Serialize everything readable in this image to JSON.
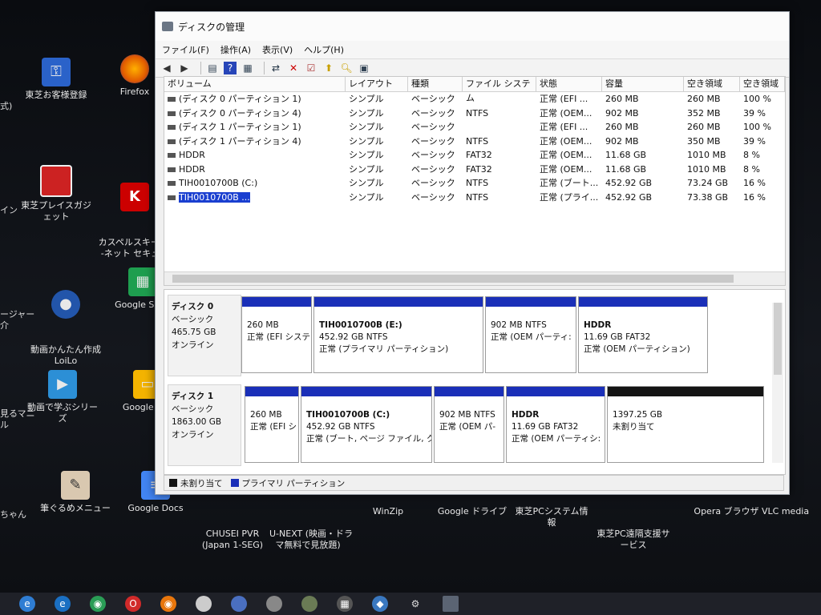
{
  "window": {
    "title": "ディスクの管理",
    "menu": [
      "ファイル(F)",
      "操作(A)",
      "表示(V)",
      "ヘルプ(H)"
    ]
  },
  "toolbar_icons": [
    "back-icon",
    "forward-icon",
    "list-view-icon",
    "help-icon",
    "properties-icon",
    "connect-icon",
    "delete-icon",
    "checklist-icon",
    "up-icon",
    "search-icon",
    "settings-icon"
  ],
  "list": {
    "columns": [
      "ボリューム",
      "レイアウト",
      "種類",
      "ファイル システム",
      "状態",
      "容量",
      "空き領域",
      "空き領域"
    ],
    "rows": [
      [
        "(ディスク 0 パーティション 1)",
        "シンプル",
        "ベーシック",
        "",
        "正常 (EFI ...",
        "260 MB",
        "260 MB",
        "100 %"
      ],
      [
        "(ディスク 0 パーティション 4)",
        "シンプル",
        "ベーシック",
        "NTFS",
        "正常 (OEM...",
        "902 MB",
        "352 MB",
        "39 %"
      ],
      [
        "(ディスク 1 パーティション 1)",
        "シンプル",
        "ベーシック",
        "",
        "正常 (EFI ...",
        "260 MB",
        "260 MB",
        "100 %"
      ],
      [
        "(ディスク 1 パーティション 4)",
        "シンプル",
        "ベーシック",
        "NTFS",
        "正常 (OEM...",
        "902 MB",
        "350 MB",
        "39 %"
      ],
      [
        "HDDR",
        "シンプル",
        "ベーシック",
        "FAT32",
        "正常 (OEM...",
        "11.68 GB",
        "1010 MB",
        "8 %"
      ],
      [
        "HDDR",
        "シンプル",
        "ベーシック",
        "FAT32",
        "正常 (OEM...",
        "11.68 GB",
        "1010 MB",
        "8 %"
      ],
      [
        "TIH0010700B (C:)",
        "シンプル",
        "ベーシック",
        "NTFS",
        "正常 (ブート...",
        "452.92 GB",
        "73.24 GB",
        "16 %"
      ],
      [
        "TIH0010700B ...",
        "シンプル",
        "ベーシック",
        "NTFS",
        "正常 (プライ...",
        "452.92 GB",
        "73.38 GB",
        "16 %"
      ]
    ]
  },
  "disks": [
    {
      "name": "ディスク 0",
      "type": "ベーシック",
      "size": "465.75 GB",
      "status": "オンライン",
      "partitions": [
        {
          "label": "",
          "size": "260 MB",
          "status": "正常 (EFI システ",
          "bar": "#1a2fb8"
        },
        {
          "label": "TIH0010700B  (E:)",
          "size": "452.92 GB NTFS",
          "status": "正常 (プライマリ パーティション)",
          "bar": "#1a2fb8"
        },
        {
          "label": "",
          "size": "902 MB NTFS",
          "status": "正常 (OEM パーティ:",
          "bar": "#1a2fb8"
        },
        {
          "label": "HDDR",
          "size": "11.69 GB FAT32",
          "status": "正常 (OEM パーティション)",
          "bar": "#1a2fb8"
        }
      ]
    },
    {
      "name": "ディスク 1",
      "type": "ベーシック",
      "size": "1863.00 GB",
      "status": "オンライン",
      "partitions": [
        {
          "label": "",
          "size": "260 MB",
          "status": "正常 (EFI シ",
          "bar": "#1a2fb8"
        },
        {
          "label": "TIH0010700B  (C:)",
          "size": "452.92 GB NTFS",
          "status": "正常 (ブート, ページ ファイル, クラッ",
          "bar": "#1a2fb8"
        },
        {
          "label": "",
          "size": "902 MB NTFS",
          "status": "正常 (OEM パ-",
          "bar": "#1a2fb8"
        },
        {
          "label": "HDDR",
          "size": "11.69 GB FAT32",
          "status": "正常 (OEM パーティシ:",
          "bar": "#1a2fb8"
        },
        {
          "label": "",
          "size": "1397.25 GB",
          "status": "未割り当て",
          "bar": "#141414"
        }
      ]
    }
  ],
  "legend": {
    "unallocated": "未割り当て",
    "primary": "プライマリ パーティション",
    "unallocated_color": "#141414",
    "primary_color": "#1a2fb8"
  },
  "desktop_icons": [
    {
      "label": "東芝お客様登録",
      "icon": "key-icon"
    },
    {
      "label": "Firefox",
      "icon": "firefox-icon"
    },
    {
      "label": "東芝プレイスガジェット",
      "icon": "gadget-icon"
    },
    {
      "label": "カスペルスキー イ\n-ネット セキュリ",
      "icon": "kaspersky-icon"
    },
    {
      "label": "動画かんたん作成\nLoiLo",
      "icon": "loilo-icon"
    },
    {
      "label": "Google Shee",
      "icon": "sheets-icon"
    },
    {
      "label": "動画で学ぶシリーズ",
      "icon": "video-series-icon"
    },
    {
      "label": "Google Slid",
      "icon": "slides-icon"
    },
    {
      "label": "筆ぐるめメニュー",
      "icon": "fudegurume-icon"
    },
    {
      "label": "Google Docs",
      "icon": "docs-icon"
    },
    {
      "label": "CHUSEI PVR\n(Japan 1-SEG)",
      "icon": "tv-icon"
    },
    {
      "label": "U-NEXT (映画・ドラ\nマ無料で見放題)",
      "icon": "unext-icon"
    },
    {
      "label": "WinZip",
      "icon": "winzip-icon"
    },
    {
      "label": "Google ドライブ",
      "icon": "drive-icon"
    },
    {
      "label": "東芝PCシステム情報",
      "icon": "sysinfo-icon"
    },
    {
      "label": "東芝PC遠隔支援サ\nービス",
      "icon": "remote-icon"
    },
    {
      "label": "Opera ブラウザ",
      "icon": "opera-icon"
    },
    {
      "label": "VLC media",
      "icon": "vlc-icon"
    }
  ],
  "left_cropped": [
    "式)",
    "イン",
    "ージャー\n介",
    "見るマニ\nル",
    "ちゃん"
  ]
}
